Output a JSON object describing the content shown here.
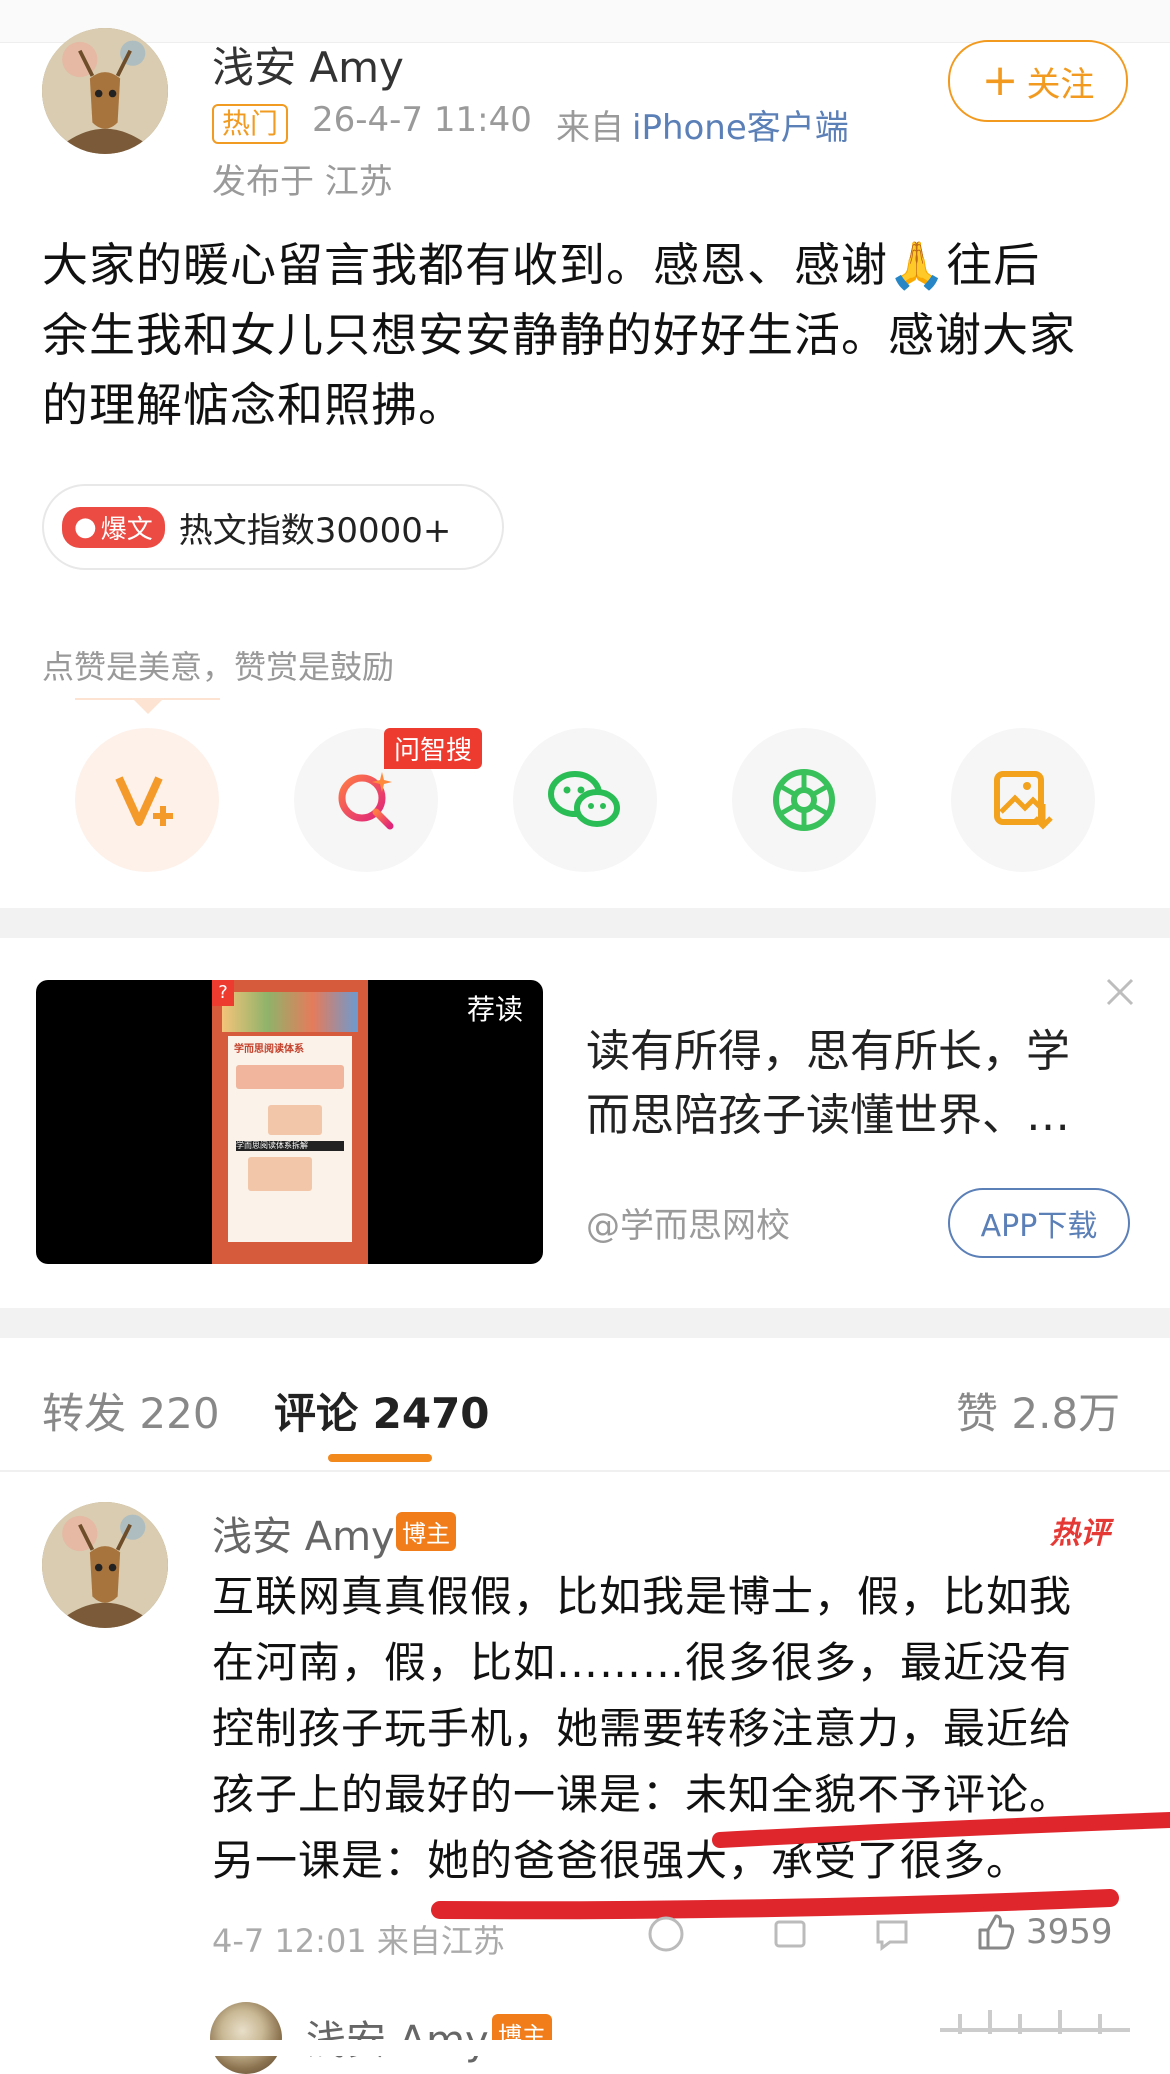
{
  "post": {
    "author": "浅安 Amy",
    "hot_tag": "热门",
    "time": "26-4-7 11:40",
    "from_prefix": "来自",
    "from_device": "iPhone客户端",
    "location": "发布于 江苏",
    "follow_label": "关注",
    "text_line1": "大家的暖心留言我都有收到。感恩、感谢🙏往后",
    "text_line2": "余生我和女儿只想安安静静的好好生活。感谢大家",
    "text_line3": "的理解惦念和照拂。",
    "hot_badge": "爆文",
    "hot_index": "热文指数30000+",
    "hint": "点赞是美意，赞赏是鼓励"
  },
  "share_bar": {
    "items": [
      {
        "icon": "reward-v-icon"
      },
      {
        "icon": "ai-search-icon",
        "badge": "问智搜"
      },
      {
        "icon": "wechat-icon"
      },
      {
        "icon": "moments-icon"
      },
      {
        "icon": "save-image-icon"
      }
    ]
  },
  "ad": {
    "thumb_label": "荐读",
    "thumb_heading": "学而思阅读体系",
    "thumb_caption": "学而思阅读体系拆解",
    "title_line1": "读有所得，思有所长，学",
    "title_line2": "而思陪孩子读懂世界、…",
    "source": "@学而思网校",
    "button": "APP下载"
  },
  "tabs": {
    "repost_label": "转发",
    "repost_count": "220",
    "comment_label": "评论",
    "comment_count": "2470",
    "like_label": "赞",
    "like_count": "2.8万"
  },
  "comment": {
    "author": "浅安 Amy",
    "role_badge": "博主",
    "hot_label": "热评",
    "line1": "互联网真真假假，比如我是博士，假，比如我",
    "line2": "在河南，假，比如………很多很多，最近没有",
    "line3": "控制孩子玩手机，她需要转移注意力，最近给",
    "line4": "孩子上的最好的一课是：未知全貌不予评论。",
    "line5": "另一课是：她的爸爸很强大，承受了很多。",
    "meta": "4-7 12:01 来自江苏",
    "likes": "3959"
  },
  "next_comment": {
    "author": "浅安 Amy",
    "role_badge": "博主"
  },
  "colors": {
    "accent_orange": "#f29a1f",
    "link_blue": "#5b7fb7",
    "hot_red": "#ec4b43",
    "annotation_red": "#e0262d"
  }
}
